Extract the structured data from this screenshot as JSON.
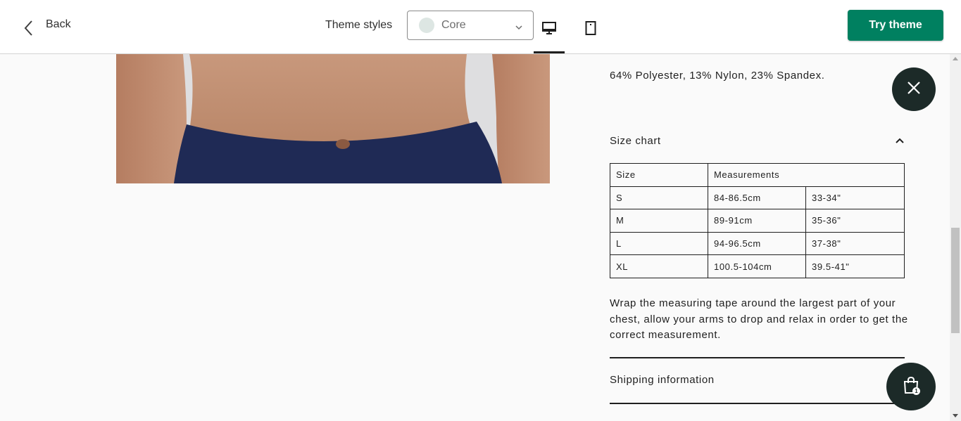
{
  "topbar": {
    "back_label": "Back",
    "theme_styles_label": "Theme styles",
    "theme_select_value": "Core",
    "theme_swatch_color": "#dde6e3",
    "try_theme_label": "Try theme",
    "try_theme_color": "#008060"
  },
  "product": {
    "material": "64% Polyester, 13% Nylon, 23% Spandex.",
    "size_chart": {
      "title": "Size chart",
      "headers": [
        "Size",
        "Measurements"
      ],
      "rows": [
        [
          "S",
          "84-86.5cm",
          "33-34\""
        ],
        [
          "M",
          "89-91cm",
          "35-36\""
        ],
        [
          "L",
          "94-96.5cm",
          "37-38\""
        ],
        [
          "XL",
          "100.5-104cm",
          "39.5-41\""
        ]
      ],
      "instructions": "Wrap the measuring tape around the largest part of your chest, allow your arms to drop and relax in order to get the correct measurement."
    },
    "shipping_title": "Shipping information"
  },
  "cart": {
    "count": "1"
  },
  "icons": {
    "back": "chevron-left-icon",
    "caret": "chevron-down-icon",
    "desktop": "desktop-icon",
    "mobile": "mobile-icon",
    "close": "close-icon",
    "collapse": "chevron-up-icon",
    "cart": "shopping-bag-icon"
  }
}
